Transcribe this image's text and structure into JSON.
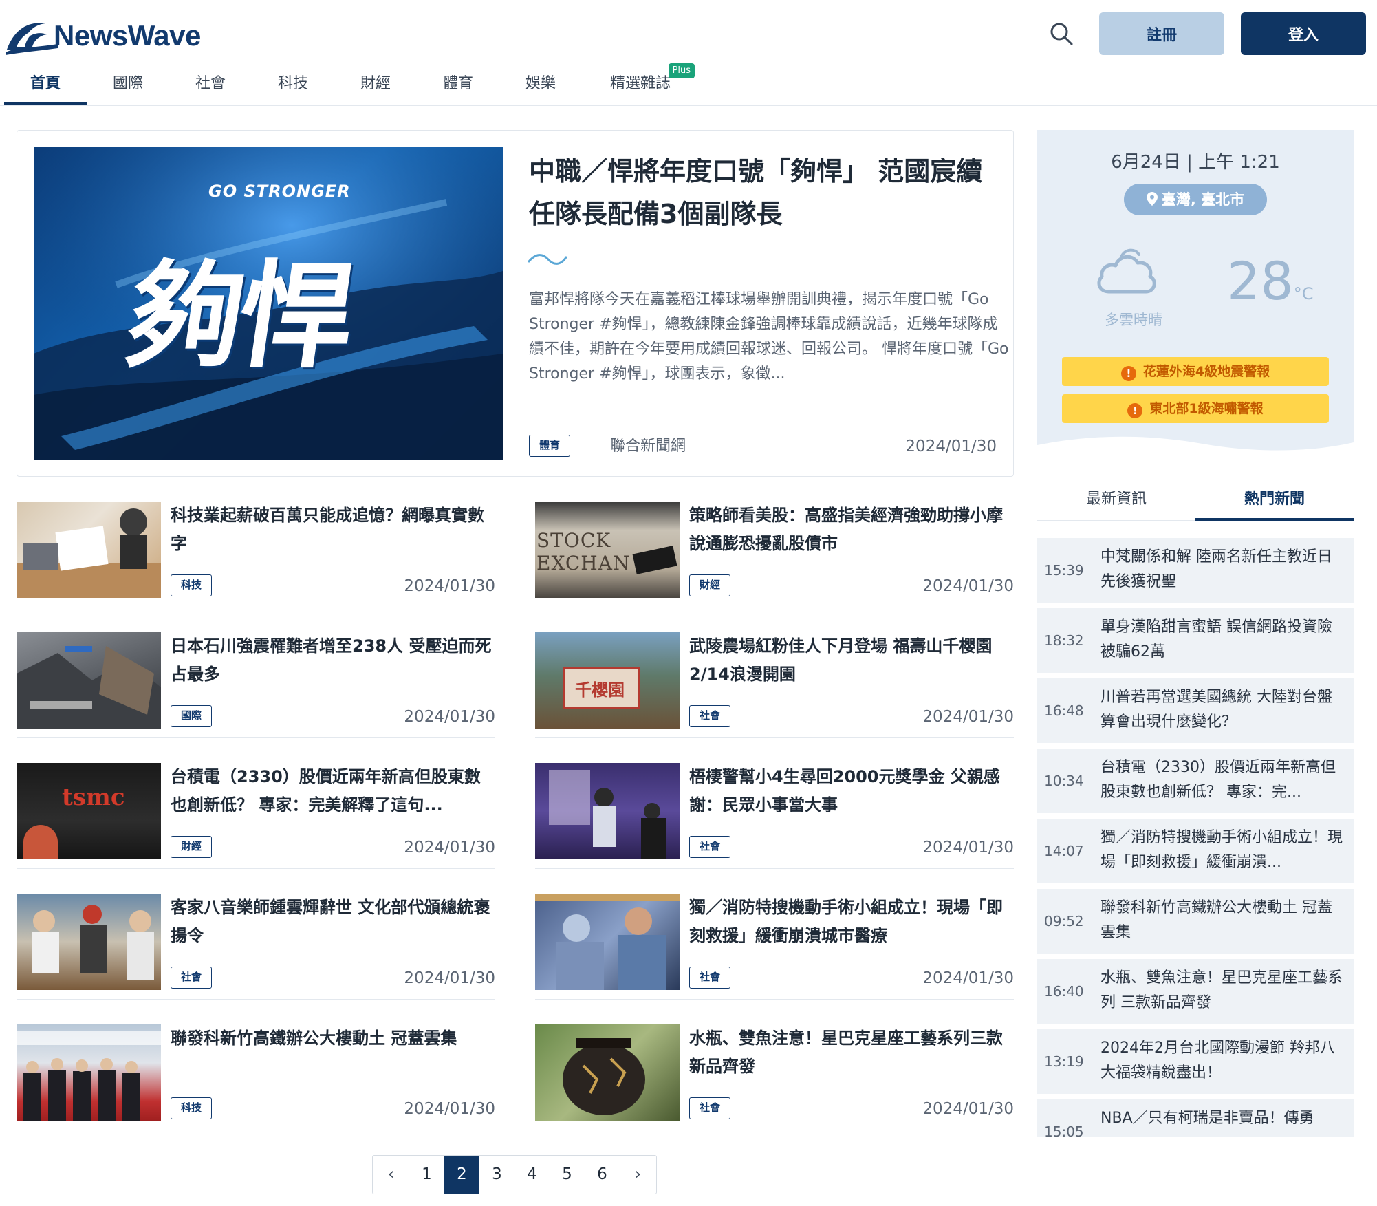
{
  "brand": {
    "name": "NewsWave"
  },
  "header": {
    "register_label": "註冊",
    "login_label": "登入"
  },
  "nav": [
    {
      "label": "首頁"
    },
    {
      "label": "國際"
    },
    {
      "label": "社會"
    },
    {
      "label": "科技"
    },
    {
      "label": "財經"
    },
    {
      "label": "體育"
    },
    {
      "label": "娛樂"
    },
    {
      "label": "精選雜誌",
      "badge": "Plus"
    }
  ],
  "featured": {
    "image_text_en": "GO STRONGER",
    "image_text_zh": "夠悍",
    "title": "中職／悍將年度口號「夠悍」 范國宸續任隊長配備3個副隊長",
    "summary": "富邦悍將隊今天在嘉義稻江棒球場舉辦開訓典禮，揭示年度口號「Go Stronger #夠悍」，總教練陳金鋒強調棒球靠成績說話，近幾年球隊成績不佳，期許在今年要用成績回報球迷、回報公司。 悍將年度口號「Go Stronger #夠悍」，球團表示，象徵...",
    "tag": "體育",
    "source": "聯合新聞網",
    "date": "2024/01/30"
  },
  "articles": [
    {
      "title": "科技業起薪破百萬只能成追憶？網曝真實數字",
      "tag": "科技",
      "date": "2024/01/30"
    },
    {
      "title": "策略師看美股：高盛指美經濟強勁助撐小摩說通膨恐擾亂股債市",
      "tag": "財經",
      "date": "2024/01/30",
      "image_text": "STOCK EXCHAN"
    },
    {
      "title": "日本石川強震罹難者增至238人 受壓迫而死占最多",
      "tag": "國際",
      "date": "2024/01/30"
    },
    {
      "title": "武陵農場紅粉佳人下月登場 福壽山千櫻園2/14浪漫開園",
      "tag": "社會",
      "date": "2024/01/30",
      "image_text": "千櫻園"
    },
    {
      "title": "台積電（2330）股價近兩年新高但股東數也創新低？ 專家：完美解釋了這句...",
      "tag": "財經",
      "date": "2024/01/30",
      "image_text": "tsmc"
    },
    {
      "title": "梧棲警幫小4生尋回2000元獎學金 父親感謝：民眾小事當大事",
      "tag": "社會",
      "date": "2024/01/30"
    },
    {
      "title": "客家八音樂師鍾雲輝辭世 文化部代頒總統褒揚令",
      "tag": "社會",
      "date": "2024/01/30"
    },
    {
      "title": "獨／消防特搜機動手術小組成立！現場「即刻救援」緩衝崩潰城市醫療",
      "tag": "社會",
      "date": "2024/01/30"
    },
    {
      "title": "聯發科新竹高鐵辦公大樓動土 冠蓋雲集",
      "tag": "科技",
      "date": "2024/01/30"
    },
    {
      "title": "水瓶、雙魚注意！星巴克星座工藝系列三款新品齊發",
      "tag": "社會",
      "date": "2024/01/30"
    }
  ],
  "pagination": {
    "prev": "‹",
    "next": "›",
    "pages": [
      "1",
      "2",
      "3",
      "4",
      "5",
      "6"
    ],
    "current": "2"
  },
  "weather": {
    "datetime": "6月24日 | 上午 1:21",
    "location": "臺灣, 臺北市",
    "condition": "多雲時晴",
    "temperature": "28",
    "unit": "°C",
    "alerts": [
      "花蓮外海4級地震警報",
      "東北部1級海嘯警報"
    ]
  },
  "sidebar_tabs": [
    {
      "label": "最新資訊"
    },
    {
      "label": "熱門新聞"
    }
  ],
  "hot_news": [
    {
      "time": "15:39",
      "title": "中梵關係和解 陸兩名新任主教近日先後獲祝聖"
    },
    {
      "time": "18:32",
      "title": "單身漢陷甜言蜜語 誤信網路投資險被騙62萬"
    },
    {
      "time": "16:48",
      "title": "川普若再當選美國總統 大陸對台盤算會出現什麼變化？"
    },
    {
      "time": "10:34",
      "title": "台積電（2330）股價近兩年新高但股東數也創新低？ 專家：完..."
    },
    {
      "time": "14:07",
      "title": "獨／消防特搜機動手術小組成立！現場「即刻救援」緩衝崩潰..."
    },
    {
      "time": "09:52",
      "title": "聯發科新竹高鐵辦公大樓動土 冠蓋雲集"
    },
    {
      "time": "16:40",
      "title": "水瓶、雙魚注意！星巴克星座工藝系列 三款新品齊發"
    },
    {
      "time": "13:19",
      "title": "2024年2月台北國際動漫節 羚邦八大福袋精銳盡出！"
    },
    {
      "time": "15:05",
      "title": "NBA／只有柯瑞是非賣品！傳勇"
    }
  ],
  "colors": {
    "primary": "#0f3563",
    "register": "#b9cfe4",
    "weather_bg": "#e7eef6",
    "alert": "#ffd54a"
  }
}
